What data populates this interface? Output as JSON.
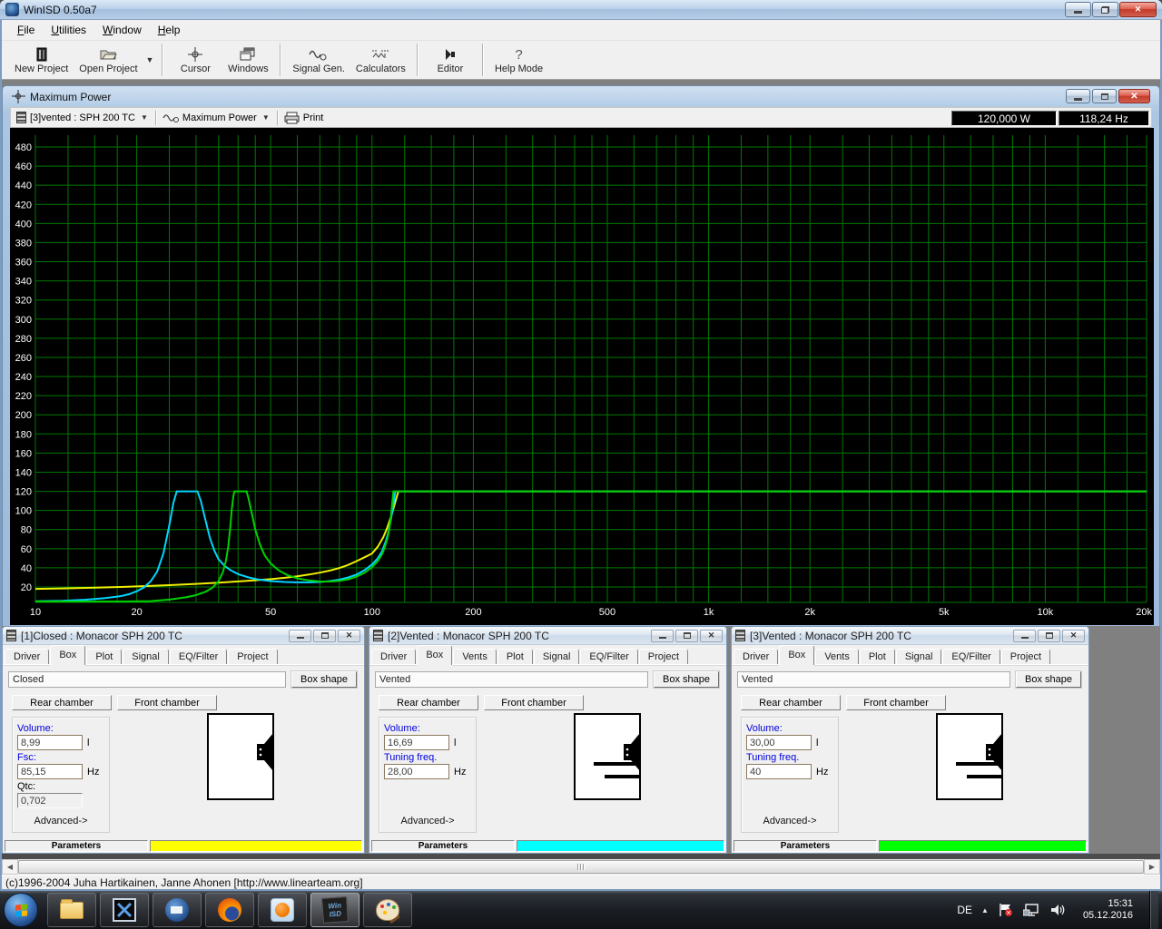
{
  "window": {
    "title": "WinISD 0.50a7"
  },
  "menu": {
    "items": [
      {
        "label": "File"
      },
      {
        "label": "Utilities"
      },
      {
        "label": "Window"
      },
      {
        "label": "Help"
      }
    ]
  },
  "toolbar": {
    "buttons": [
      {
        "label": "New Project"
      },
      {
        "label": "Open Project"
      },
      {
        "label": "Cursor"
      },
      {
        "label": "Windows"
      },
      {
        "label": "Signal Gen."
      },
      {
        "label": "Calculators"
      },
      {
        "label": "Editor"
      },
      {
        "label": "Help Mode"
      }
    ]
  },
  "plot_window": {
    "title": "Maximum Power",
    "project_selector": "[3]vented : SPH 200 TC",
    "graph_selector": "Maximum Power",
    "print_label": "Print",
    "readout_power": "120,000 W",
    "readout_freq": "118,24 Hz"
  },
  "chart_data": {
    "type": "line",
    "title": "Maximum Power",
    "grid": true,
    "background": "#000000",
    "grid_color": "#007a00",
    "label_color": "#ffffff",
    "x_axis": {
      "scale": "log",
      "min": 10,
      "max": 20000,
      "unit": "Hz",
      "tick_values": [
        10,
        20,
        50,
        100,
        200,
        500,
        1000,
        2000,
        5000,
        10000,
        20000
      ],
      "tick_labels": [
        "10",
        "20",
        "50",
        "100",
        "200",
        "500",
        "1k",
        "2k",
        "5k",
        "10k",
        "20k"
      ],
      "minor_multipliers_per_decade": [
        1,
        1.25,
        1.5,
        1.75,
        2,
        2.5,
        3,
        3.5,
        4,
        4.5,
        5,
        6,
        7,
        8,
        9
      ]
    },
    "y_axis": {
      "min": 0,
      "max": 490,
      "unit": "W",
      "grid_step": 20,
      "label_min": 20,
      "label_max": 480,
      "label_step": 20
    },
    "series": [
      {
        "name": "[1]Closed : Monacor SPH 200 TC",
        "color": "#f0f000",
        "points": [
          [
            10,
            18
          ],
          [
            12,
            18.5
          ],
          [
            15,
            19.2
          ],
          [
            18,
            20
          ],
          [
            20,
            20.6
          ],
          [
            25,
            21.9
          ],
          [
            30,
            23.2
          ],
          [
            35,
            24.5
          ],
          [
            40,
            25.8
          ],
          [
            45,
            27
          ],
          [
            50,
            28.2
          ],
          [
            55,
            29.6
          ],
          [
            60,
            31.2
          ],
          [
            65,
            33
          ],
          [
            70,
            35
          ],
          [
            75,
            37.2
          ],
          [
            80,
            39.8
          ],
          [
            85,
            43
          ],
          [
            90,
            47
          ],
          [
            95,
            51
          ],
          [
            100,
            55
          ],
          [
            104,
            62
          ],
          [
            108,
            72
          ],
          [
            111,
            82
          ],
          [
            114,
            94
          ],
          [
            116,
            103
          ],
          [
            118,
            112
          ],
          [
            119.5,
            119
          ],
          [
            120.5,
            120
          ],
          [
            20000,
            120
          ]
        ]
      },
      {
        "name": "[2]Vented : Monacor SPH 200 TC",
        "color": "#00d5ff",
        "points": [
          [
            10,
            5
          ],
          [
            12,
            5.6
          ],
          [
            14,
            6.6
          ],
          [
            16,
            8.2
          ],
          [
            18,
            10.5
          ],
          [
            19,
            12.5
          ],
          [
            20,
            15.5
          ],
          [
            21,
            19.5
          ],
          [
            22,
            26
          ],
          [
            23,
            36
          ],
          [
            24,
            55
          ],
          [
            25,
            85
          ],
          [
            25.7,
            108
          ],
          [
            26.3,
            120
          ],
          [
            30.3,
            120
          ],
          [
            31,
            110
          ],
          [
            32,
            90
          ],
          [
            33,
            71
          ],
          [
            34,
            58
          ],
          [
            35,
            49
          ],
          [
            36.5,
            42
          ],
          [
            38,
            37.5
          ],
          [
            40,
            33.5
          ],
          [
            43,
            30
          ],
          [
            46,
            27.8
          ],
          [
            50,
            26.2
          ],
          [
            55,
            25.2
          ],
          [
            60,
            24.8
          ],
          [
            65,
            24.8
          ],
          [
            70,
            25.2
          ],
          [
            75,
            26.2
          ],
          [
            80,
            27.8
          ],
          [
            85,
            30
          ],
          [
            90,
            33
          ],
          [
            95,
            37.5
          ],
          [
            100,
            43.5
          ],
          [
            104,
            50
          ],
          [
            107,
            57
          ],
          [
            110,
            68
          ],
          [
            112,
            78
          ],
          [
            114,
            92
          ],
          [
            115.5,
            104
          ],
          [
            116.6,
            114
          ],
          [
            117.3,
            120
          ],
          [
            20000,
            120
          ]
        ]
      },
      {
        "name": "[3]Vented : Monacor SPH 200 TC",
        "color": "#00d000",
        "points": [
          [
            10,
            2
          ],
          [
            14,
            2.8
          ],
          [
            18,
            3.8
          ],
          [
            22,
            5.2
          ],
          [
            25,
            6.8
          ],
          [
            28,
            9.2
          ],
          [
            30,
            11.5
          ],
          [
            32,
            15
          ],
          [
            33.5,
            19
          ],
          [
            35,
            26
          ],
          [
            36,
            35
          ],
          [
            36.8,
            47
          ],
          [
            37.4,
            62
          ],
          [
            37.9,
            82
          ],
          [
            38.3,
            100
          ],
          [
            38.7,
            114
          ],
          [
            39,
            120
          ],
          [
            42.4,
            120
          ],
          [
            43,
            112
          ],
          [
            44,
            96
          ],
          [
            45,
            80
          ],
          [
            46.5,
            64
          ],
          [
            48,
            53
          ],
          [
            50,
            44.5
          ],
          [
            53,
            37
          ],
          [
            56,
            32.5
          ],
          [
            60,
            29
          ],
          [
            65,
            26.8
          ],
          [
            70,
            25.8
          ],
          [
            75,
            25.7
          ],
          [
            80,
            26.4
          ],
          [
            85,
            28
          ],
          [
            90,
            30.8
          ],
          [
            95,
            34.8
          ],
          [
            100,
            40.5
          ],
          [
            104,
            47
          ],
          [
            107,
            54
          ],
          [
            109,
            61
          ],
          [
            111,
            70
          ],
          [
            112.5,
            80
          ],
          [
            113.6,
            91
          ],
          [
            114.5,
            103
          ],
          [
            115.2,
            113
          ],
          [
            115.7,
            120
          ],
          [
            20000,
            120
          ]
        ]
      }
    ],
    "readout": {
      "power": "120,000 W",
      "frequency": "118,24 Hz"
    }
  },
  "panels": [
    {
      "title": "[1]Closed : Monacor SPH 200 TC",
      "tabs": [
        "Driver",
        "Box",
        "Plot",
        "Signal",
        "EQ/Filter",
        "Project"
      ],
      "active_tab": "Box",
      "box_type": "Closed",
      "box_shape": "Box shape",
      "rear_chamber": "Rear chamber",
      "front_chamber": "Front chamber",
      "fields": [
        {
          "label": "Volume:",
          "value": "8,99",
          "unit": "l"
        },
        {
          "label": "Fsc:",
          "value": "85,15",
          "unit": "Hz"
        },
        {
          "label": "Qtc:",
          "value": "0,702",
          "unit": ""
        }
      ],
      "advanced": "Advanced->",
      "parameters": "Parameters",
      "color": "#ffff00"
    },
    {
      "title": "[2]Vented : Monacor SPH 200 TC",
      "tabs": [
        "Driver",
        "Box",
        "Vents",
        "Plot",
        "Signal",
        "EQ/Filter",
        "Project"
      ],
      "active_tab": "Box",
      "box_type": "Vented",
      "box_shape": "Box shape",
      "rear_chamber": "Rear chamber",
      "front_chamber": "Front chamber",
      "fields": [
        {
          "label": "Volume:",
          "value": "16,69",
          "unit": "l"
        },
        {
          "label": "Tuning freq.",
          "value": "28,00",
          "unit": "Hz"
        }
      ],
      "advanced": "Advanced->",
      "parameters": "Parameters",
      "color": "#00ffff"
    },
    {
      "title": "[3]Vented : Monacor SPH 200 TC",
      "tabs": [
        "Driver",
        "Box",
        "Vents",
        "Plot",
        "Signal",
        "EQ/Filter",
        "Project"
      ],
      "active_tab": "Box",
      "box_type": "Vented",
      "box_shape": "Box shape",
      "rear_chamber": "Rear chamber",
      "front_chamber": "Front chamber",
      "fields": [
        {
          "label": "Volume:",
          "value": "30,00",
          "unit": "l"
        },
        {
          "label": "Tuning freq.",
          "value": "40",
          "unit": "Hz"
        }
      ],
      "advanced": "Advanced->",
      "parameters": "Parameters",
      "color": "#00ff00"
    }
  ],
  "status_bar": {
    "text": "(c)1996-2004 Juha Hartikainen, Janne Ahonen [http://www.linearteam.org]"
  },
  "taskbar": {
    "language": "DE",
    "time": "15:31",
    "date": "05.12.2016",
    "app_icons": [
      "start",
      "windows-explorer",
      "crossed-arrows-app",
      "thunderbird",
      "firefox",
      "media-player",
      "winisd",
      "paint"
    ],
    "tray_icons": [
      "hidden-icons-chevron",
      "action-center-flag",
      "network",
      "volume"
    ],
    "winisd_icon_text_top": "Win",
    "winisd_icon_text_bottom": "ISD"
  }
}
